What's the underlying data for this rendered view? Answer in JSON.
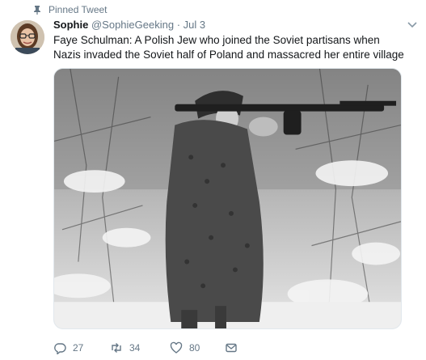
{
  "pinned": {
    "label": "Pinned Tweet"
  },
  "tweet": {
    "name": "Sophie",
    "handle": "@SophieGeeking",
    "separator": "·",
    "time": "Jul 3",
    "text": "Faye Schulman: A Polish Jew who joined the Soviet partisans when Nazis invaded the Soviet half of Poland and massacred her entire village"
  },
  "actions": {
    "reply_count": "27",
    "retweet_count": "34",
    "like_count": "80"
  },
  "icons": {
    "pin": "pin-icon",
    "caret": "chevron-down-icon",
    "reply": "reply-icon",
    "retweet": "retweet-icon",
    "like": "heart-icon",
    "dm": "envelope-icon"
  },
  "colors": {
    "secondary_text": "#657786",
    "primary_text": "#14171a",
    "border": "#e1e8ed"
  }
}
